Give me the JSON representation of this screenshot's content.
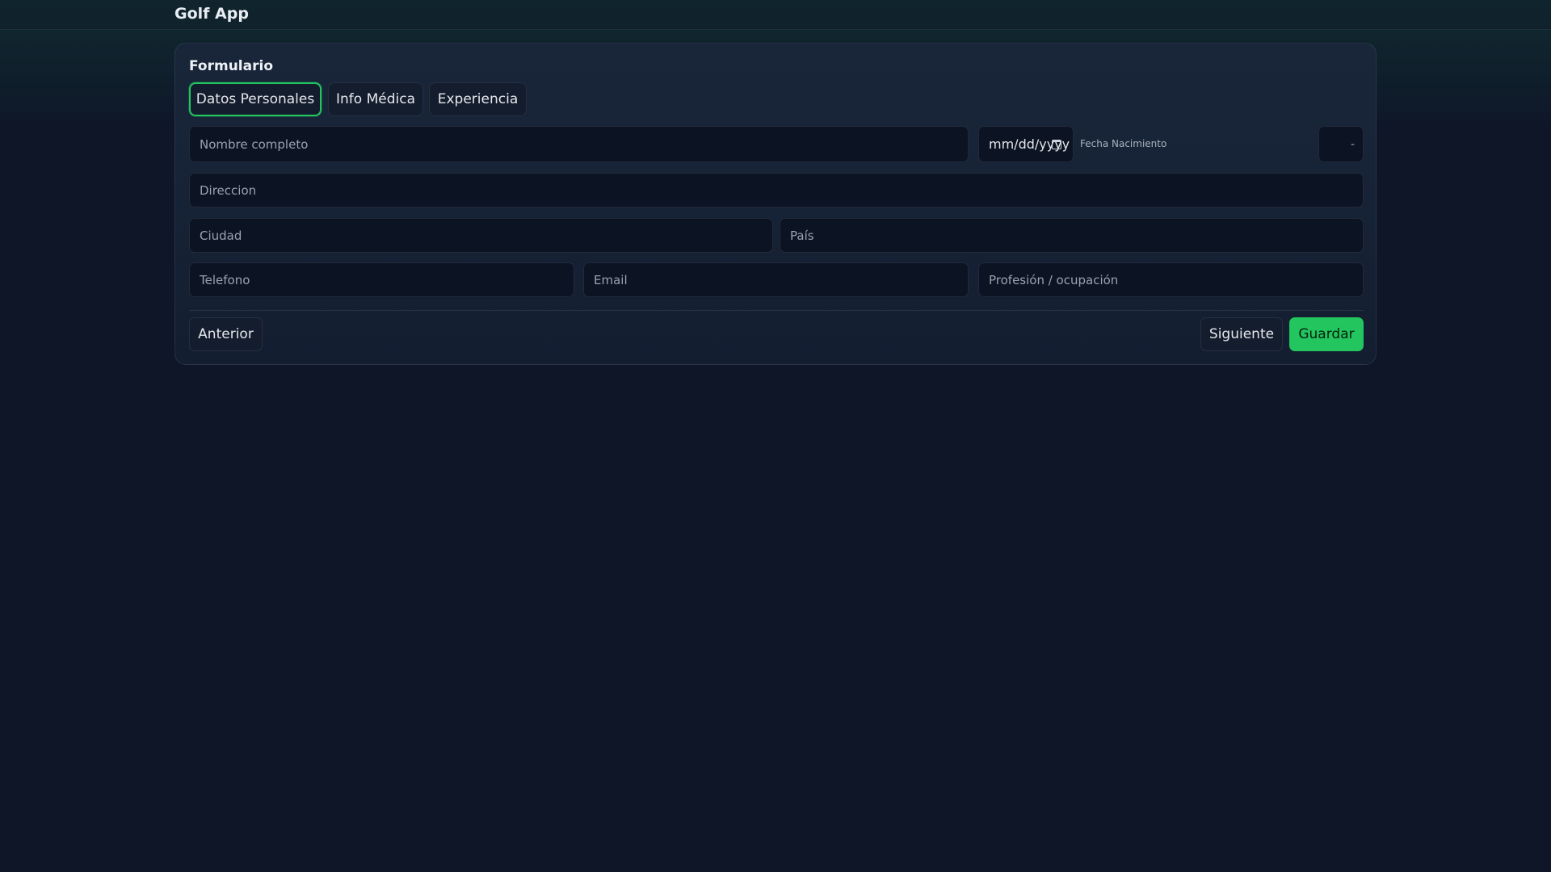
{
  "app": {
    "title": "Golf App"
  },
  "form": {
    "title": "Formulario",
    "tabs": [
      {
        "label": "Datos Personales",
        "active": true
      },
      {
        "label": "Info Médica",
        "active": false
      },
      {
        "label": "Experiencia",
        "active": false
      }
    ],
    "fields": {
      "nombre_placeholder": "Nombre completo",
      "fecha_value": "mm/dd/yyyy",
      "fecha_label": "Fecha Nacimiento",
      "edad_value": "-",
      "direccion_placeholder": "Direccion",
      "ciudad_placeholder": "Ciudad",
      "pais_placeholder": "País",
      "telefono_placeholder": "Telefono",
      "email_placeholder": "Email",
      "profesion_placeholder": "Profesión / ocupación"
    },
    "buttons": {
      "anterior": "Anterior",
      "siguiente": "Siguiente",
      "guardar": "Guardar"
    }
  },
  "colors": {
    "background": "#0e1628",
    "accent": "#22c55e"
  }
}
